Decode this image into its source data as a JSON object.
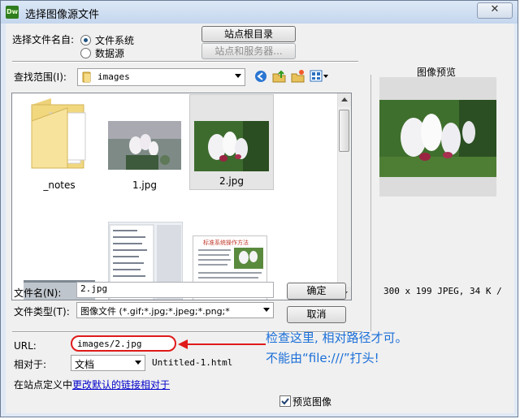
{
  "window": {
    "title": "选择图像源文件",
    "app_icon": "Dw",
    "close_glyph": "✕"
  },
  "select_from": {
    "label": "选择文件名自:",
    "option_filesystem": "文件系统",
    "option_datasource": "数据源",
    "site_root_button": "站点根目录",
    "site_server_button": "站点和服务器..."
  },
  "lookin": {
    "label": "查找范围(I):",
    "value": "images"
  },
  "files": [
    {
      "name": "_notes",
      "kind": "folder"
    },
    {
      "name": "1.jpg",
      "kind": "image"
    },
    {
      "name": "2.jpg",
      "kind": "image"
    }
  ],
  "doc_thumb": {
    "heading": "标准系统操作方法"
  },
  "filename": {
    "label": "文件名(N):",
    "value": "2.jpg"
  },
  "filetype": {
    "label": "文件类型(T):",
    "value": "图像文件 (*.gif;*.jpg;*.jpeg;*.png;*"
  },
  "ok_button": "确定",
  "cancel_button": "取消",
  "preview": {
    "title": "图像预览",
    "info": "300 x 199 JPEG, 34 K /"
  },
  "url": {
    "label": "URL:",
    "value": "images/2.jpg"
  },
  "relative": {
    "label": "相对于:",
    "value": "文档",
    "doc_name": "Untitled-1.html"
  },
  "site_def": {
    "prefix": "在站点定义中",
    "link": "更改默认的链接相对于"
  },
  "preview_checkbox": {
    "label": "预览图像",
    "checked": true
  },
  "annotation": {
    "line1": "检查这里, 相对路径才可。",
    "line2": "不能由“file:///”打头!"
  },
  "colors": {
    "annotation": "#1b6fd8",
    "highlight": "#e01a1a",
    "link": "#0000cc"
  }
}
